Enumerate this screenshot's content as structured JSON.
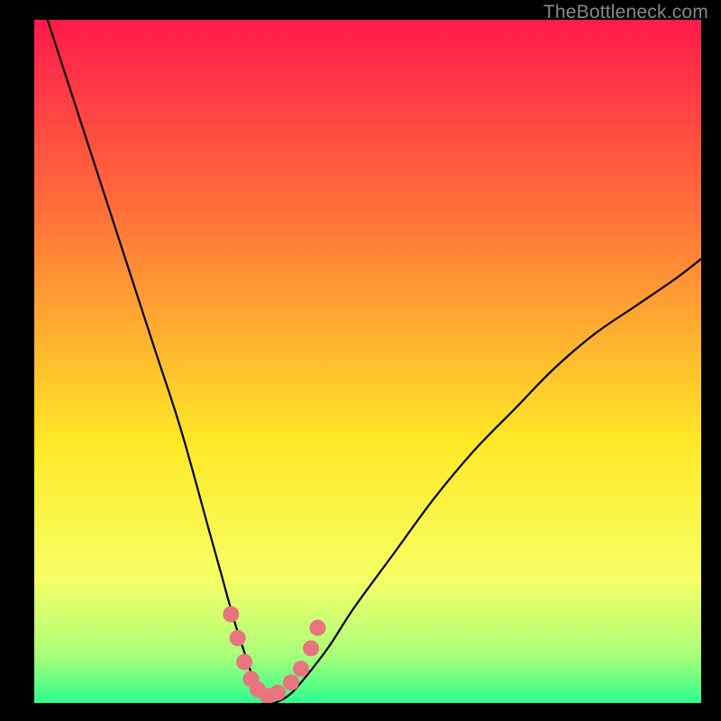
{
  "watermark": "TheBottleneck.com",
  "chart_data": {
    "type": "line",
    "title": "",
    "xlabel": "",
    "ylabel": "",
    "xlim": [
      0,
      100
    ],
    "ylim": [
      0,
      100
    ],
    "grid": false,
    "legend": false,
    "background_gradient": {
      "top_color": "#ff1a4c",
      "mid_color": "#ffe927",
      "bottom_color": "#2dfd8e"
    },
    "series": [
      {
        "name": "bottleneck-curve",
        "type": "line",
        "color": "#000000",
        "x": [
          2,
          6,
          10,
          14,
          18,
          22,
          26,
          28,
          30,
          32,
          33,
          34,
          35,
          36,
          38,
          40,
          44,
          48,
          54,
          60,
          66,
          72,
          78,
          84,
          90,
          96,
          100
        ],
        "y": [
          100,
          88,
          76,
          64,
          52,
          40,
          26,
          19,
          12,
          6,
          3,
          1,
          0,
          0,
          1,
          3,
          8,
          14,
          22,
          30,
          37,
          43,
          49,
          54,
          58,
          62,
          65
        ]
      },
      {
        "name": "highlight-points",
        "type": "scatter",
        "color": "#e9747e",
        "x": [
          29.5,
          30.5,
          31.5,
          32.5,
          33.5,
          35.0,
          36.5,
          38.5,
          40.0,
          41.5,
          42.5
        ],
        "y": [
          13.0,
          9.5,
          6.0,
          3.5,
          2.0,
          1.0,
          1.5,
          3.0,
          5.0,
          8.0,
          11.0
        ]
      }
    ]
  }
}
